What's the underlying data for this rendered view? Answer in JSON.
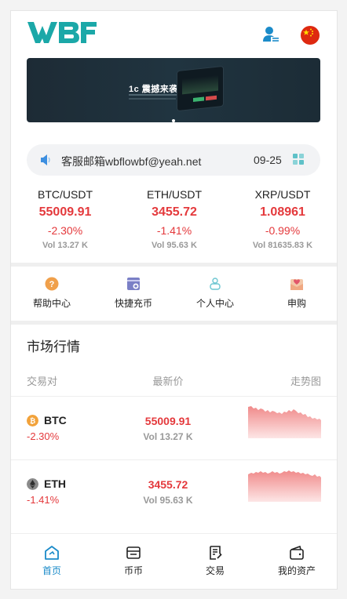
{
  "header": {
    "logo_text": "WBF",
    "logo_color": "#1ba8a8",
    "user_icon": "user-icon",
    "flag_icon": "china-flag-icon"
  },
  "banner": {
    "text": "1c 震撼来袭"
  },
  "notice": {
    "text": "客服邮箱wbflowbf@yeah.net",
    "date": "09-25",
    "icon": "speaker-icon",
    "menu_icon": "grid-icon"
  },
  "tickers": [
    {
      "pair": "BTC/USDT",
      "price": "55009.91",
      "change": "-2.30%",
      "vol": "Vol 13.27 K"
    },
    {
      "pair": "ETH/USDT",
      "price": "3455.72",
      "change": "-1.41%",
      "vol": "Vol 95.63 K"
    },
    {
      "pair": "XRP/USDT",
      "price": "1.08961",
      "change": "-0.99%",
      "vol": "Vol 81635.83 K"
    }
  ],
  "quick_menu": [
    {
      "label": "帮助中心",
      "icon": "help-icon"
    },
    {
      "label": "快捷充币",
      "icon": "deposit-icon"
    },
    {
      "label": "个人中心",
      "icon": "profile-icon"
    },
    {
      "label": "申购",
      "icon": "envelope-icon"
    }
  ],
  "market": {
    "title": "市场行情",
    "headers": {
      "pair": "交易对",
      "price": "最新价",
      "trend": "走势图"
    },
    "rows": [
      {
        "coin": "BTC",
        "change": "-2.30%",
        "price": "55009.91",
        "vol": "Vol 13.27 K",
        "icon": "bitcoin-icon"
      },
      {
        "coin": "ETH",
        "change": "-1.41%",
        "price": "3455.72",
        "vol": "Vol 95.63 K",
        "icon": "ethereum-icon"
      }
    ]
  },
  "bottom_nav": [
    {
      "label": "首页",
      "icon": "home-icon",
      "active": true
    },
    {
      "label": "币币",
      "icon": "wallet-card-icon",
      "active": false
    },
    {
      "label": "交易",
      "icon": "trade-doc-icon",
      "active": false
    },
    {
      "label": "我的资产",
      "icon": "assets-wallet-icon",
      "active": false
    }
  ],
  "colors": {
    "accent": "#1b8bc9",
    "down": "#e4393c",
    "muted": "#999999"
  }
}
